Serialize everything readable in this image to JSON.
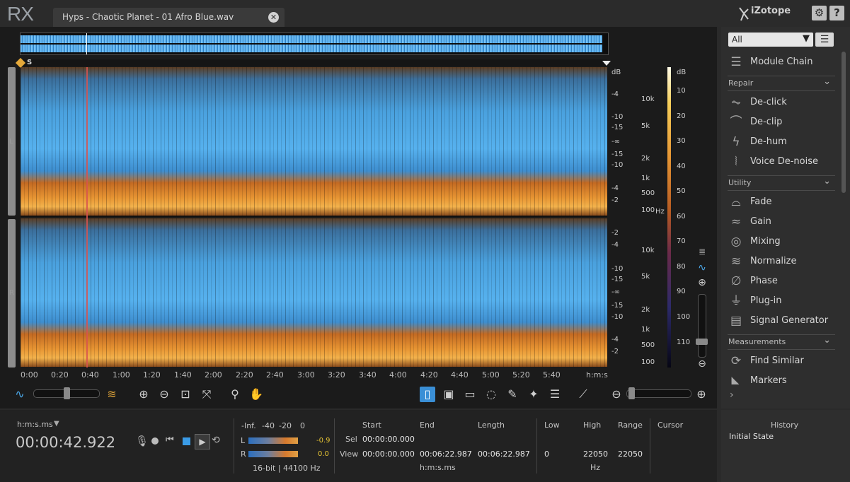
{
  "app": {
    "logo": "RX",
    "brand": "iZotope",
    "settings_icon": "gear-icon",
    "help_label": "?"
  },
  "file_tab": {
    "title": "Hyps - Chaotic Planet - 01 Afro Blue.wav",
    "close_label": "✕"
  },
  "channels": {
    "left": "L",
    "right": "R",
    "start_marker": "S"
  },
  "freq_scale": {
    "db_label": "dB",
    "hz_label": "Hz",
    "left_ticks": [
      "-4",
      "-10",
      "-15",
      "-∞",
      "-15",
      "-10",
      "-4",
      "-2"
    ],
    "left_hz": [
      "10k",
      "5k",
      "2k",
      "1k",
      "500",
      "100"
    ],
    "right_ticks": [
      "-2",
      "-4",
      "-10",
      "-15",
      "-∞",
      "-15",
      "-10",
      "-4",
      "-2"
    ],
    "right_hz": [
      "10k",
      "5k",
      "2k",
      "1k",
      "500",
      "100"
    ]
  },
  "color_scale": {
    "label": "dB",
    "ticks": [
      "10",
      "20",
      "30",
      "40",
      "50",
      "60",
      "70",
      "80",
      "90",
      "100",
      "110"
    ]
  },
  "time_ruler": {
    "ticks": [
      "0:00",
      "0:20",
      "0:40",
      "1:00",
      "1:20",
      "1:40",
      "2:00",
      "2:20",
      "2:40",
      "3:00",
      "3:20",
      "3:40",
      "4:00",
      "4:20",
      "4:40",
      "5:00",
      "5:20",
      "5:40"
    ],
    "unit": "h:m:s"
  },
  "module_panel": {
    "filter_value": "All",
    "module_chain": "Module Chain",
    "sections": [
      {
        "name": "Repair",
        "items": [
          {
            "label": "De-click",
            "icon": "declick-icon"
          },
          {
            "label": "De-clip",
            "icon": "declip-icon"
          },
          {
            "label": "De-hum",
            "icon": "dehum-icon"
          },
          {
            "label": "Voice De-noise",
            "icon": "voice-denoise-icon"
          }
        ]
      },
      {
        "name": "Utility",
        "items": [
          {
            "label": "Fade",
            "icon": "fade-icon"
          },
          {
            "label": "Gain",
            "icon": "gain-icon"
          },
          {
            "label": "Mixing",
            "icon": "mixing-icon"
          },
          {
            "label": "Normalize",
            "icon": "normalize-icon"
          },
          {
            "label": "Phase",
            "icon": "phase-icon"
          },
          {
            "label": "Plug-in",
            "icon": "plugin-icon"
          },
          {
            "label": "Signal Generator",
            "icon": "signal-generator-icon"
          }
        ]
      },
      {
        "name": "Measurements",
        "items": [
          {
            "label": "Find Similar",
            "icon": "find-similar-icon"
          },
          {
            "label": "Markers",
            "icon": "markers-icon"
          }
        ]
      }
    ]
  },
  "transport": {
    "time_format": "h:m:s.ms",
    "current_time": "00:00:42.922"
  },
  "meters": {
    "scale": [
      "-Inf.",
      "-40",
      "-20",
      "0"
    ],
    "left_label": "L",
    "right_label": "R",
    "left_peak": "-0.9",
    "right_peak": "0.0",
    "format": "16-bit | 44100 Hz"
  },
  "selection": {
    "headers": {
      "start": "Start",
      "end": "End",
      "length": "Length",
      "low": "Low",
      "high": "High",
      "range": "Range",
      "cursor": "Cursor"
    },
    "sel_label": "Sel",
    "view_label": "View",
    "sel": {
      "start": "00:00:00.000"
    },
    "view": {
      "start": "00:00:00.000",
      "end": "00:06:22.987",
      "length": "00:06:22.987",
      "low": "0",
      "high": "22050",
      "range": "22050"
    },
    "time_unit": "h:m:s.ms",
    "freq_unit": "Hz"
  },
  "history": {
    "title": "History",
    "items": [
      "Initial State"
    ]
  }
}
